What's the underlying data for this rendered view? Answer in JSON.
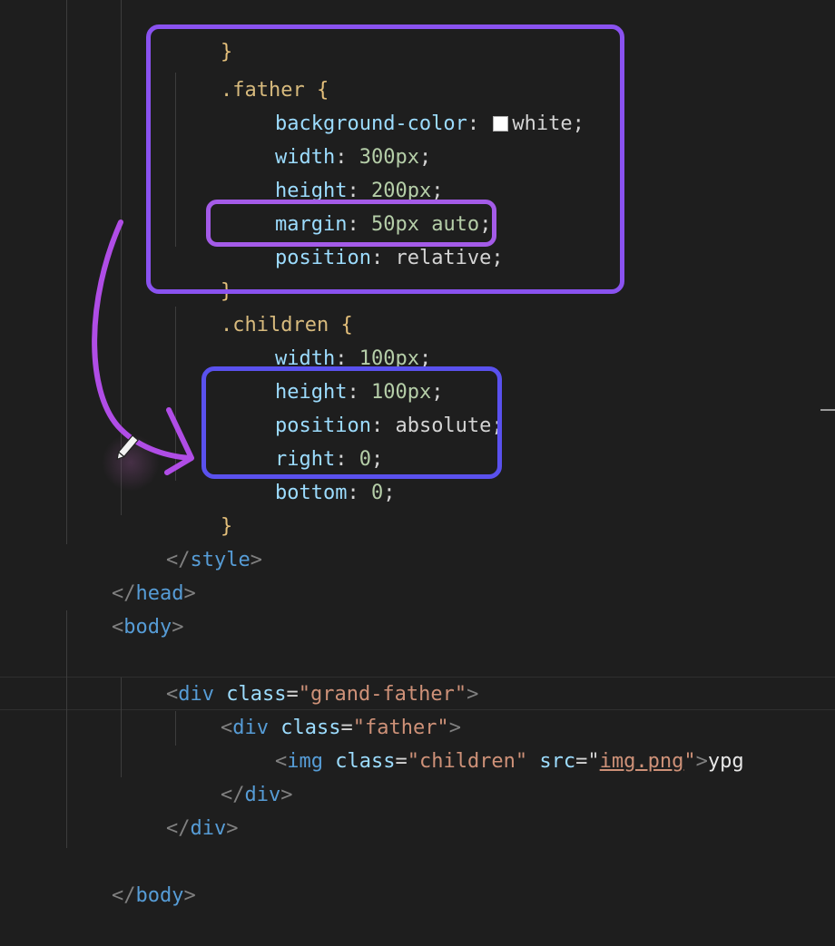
{
  "colors": {
    "background": "#1e1e1e",
    "father_box": "#8a52f0",
    "relative_box": "#a45be8",
    "absolute_box": "#5a51ee",
    "arrow": "#b04de6"
  },
  "icons": {
    "color_swatch": "white-color-swatch-icon",
    "cursor": "pencil-cursor-icon"
  },
  "code": {
    "top_clip": "}",
    "father": {
      "selector": ".father",
      "open": " {",
      "bg_prop": "background-color",
      "bg_val": "white",
      "width_prop": "width",
      "width_val": "300px",
      "height_prop": "height",
      "height_val": "200px",
      "margin_prop": "margin",
      "margin_val": "50px auto",
      "position_prop": "position",
      "position_val": "relative",
      "close": "}"
    },
    "children": {
      "selector": ".children",
      "open": " {",
      "width_prop": "width",
      "width_val": "100px",
      "height_prop": "height",
      "height_val": "100px",
      "position_prop": "position",
      "position_val": "absolute",
      "right_prop": "right",
      "right_val": "0",
      "bottom_prop": "bottom",
      "bottom_val": "0",
      "close": "}"
    },
    "style_close": "style",
    "head_close": "head",
    "body_open": "body",
    "grand_father_div": {
      "tag": "div",
      "attr": "class",
      "value": "\"grand-father\""
    },
    "father_div": {
      "tag": "div",
      "attr": "class",
      "value": "\"father\""
    },
    "img": {
      "tag": "img",
      "class_attr": "class",
      "class_value": "\"children\"",
      "src_attr": "src",
      "src_value": "img.png",
      "trailing_text": "ypg"
    },
    "father_div_close": "div",
    "grand_father_div_close": "div",
    "body_close": "body"
  }
}
